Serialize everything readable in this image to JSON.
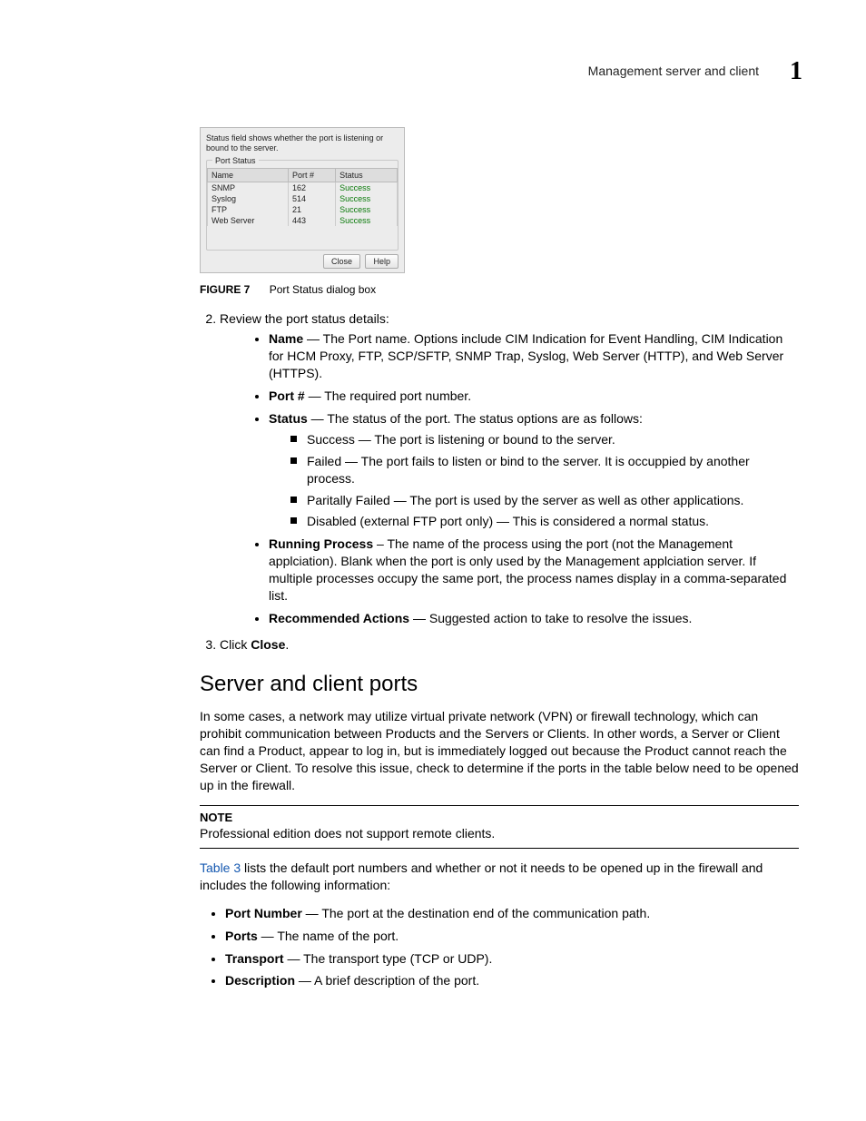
{
  "header": {
    "running_title": "Management server and client",
    "chapter_number": "1"
  },
  "dialog": {
    "message": "Status field shows whether the port is listening or bound to the server.",
    "group_title": "Port Status",
    "columns": [
      "Name",
      "Port #",
      "Status"
    ],
    "rows": [
      {
        "name": "SNMP",
        "port": "162",
        "status": "Success"
      },
      {
        "name": "Syslog",
        "port": "514",
        "status": "Success"
      },
      {
        "name": "FTP",
        "port": "21",
        "status": "Success"
      },
      {
        "name": "Web Server",
        "port": "443",
        "status": "Success"
      }
    ],
    "close_label": "Close",
    "help_label": "Help"
  },
  "figure": {
    "lead": "FIGURE 7",
    "caption": "Port Status dialog box"
  },
  "step2": {
    "text": "Review the port status details:",
    "items": {
      "name": {
        "label": "Name",
        "desc": " — The Port name. Options include CIM Indication for Event Handling, CIM Indication for HCM Proxy, FTP, SCP/SFTP, SNMP Trap, Syslog, Web Server (HTTP), and Web Server (HTTPS)."
      },
      "port": {
        "label": "Port #",
        "desc": " — The required port number."
      },
      "status": {
        "label": "Status",
        "desc": " — The status of the port. The status options are as follows:"
      },
      "running": {
        "label": "Running Process",
        "desc": " – The name of the process using the port (not the Management applciation). Blank when the port is only used by the Management applciation server. If multiple processes occupy the same port, the process names display in a comma-separated list."
      },
      "rec": {
        "label": "Recommended Actions",
        "desc": " — Suggested action to take to resolve the issues."
      }
    },
    "status_sub": [
      "Success — The port is listening or bound to the server.",
      "Failed — The port fails to listen or bind to the server. It is occuppied by another process.",
      "Paritally Failed — The port is used by the server as well as other applications.",
      "Disabled (external FTP port only) — This is considered a normal status."
    ]
  },
  "step3": {
    "pre": "Click ",
    "bold": "Close",
    "post": "."
  },
  "section2": {
    "heading": "Server and client ports",
    "para": "In some cases, a network may utilize virtual private network (VPN) or firewall technology, which can prohibit communication between Products and the Servers or Clients. In other words, a Server or Client can find a Product, appear to log in, but is immediately logged out because the Product cannot reach the Server or Client. To resolve this issue, check to determine if the ports in the table below need to be opened up in the firewall.",
    "note_head": "NOTE",
    "note_body": "Professional edition does not support remote clients.",
    "table_ref": "Table 3",
    "table_para": " lists the default port numbers and whether or not it needs to be opened up in the firewall and includes the following information:",
    "list": {
      "portnum": {
        "label": "Port Number",
        "desc": " — The port at the destination end of the communication path."
      },
      "ports": {
        "label": "Ports",
        "desc": " — The name of the port."
      },
      "transport": {
        "label": "Transport",
        "desc": " — The transport type (TCP or UDP)."
      },
      "desc": {
        "label": "Description",
        "desc": " — A brief description of the port."
      }
    }
  }
}
